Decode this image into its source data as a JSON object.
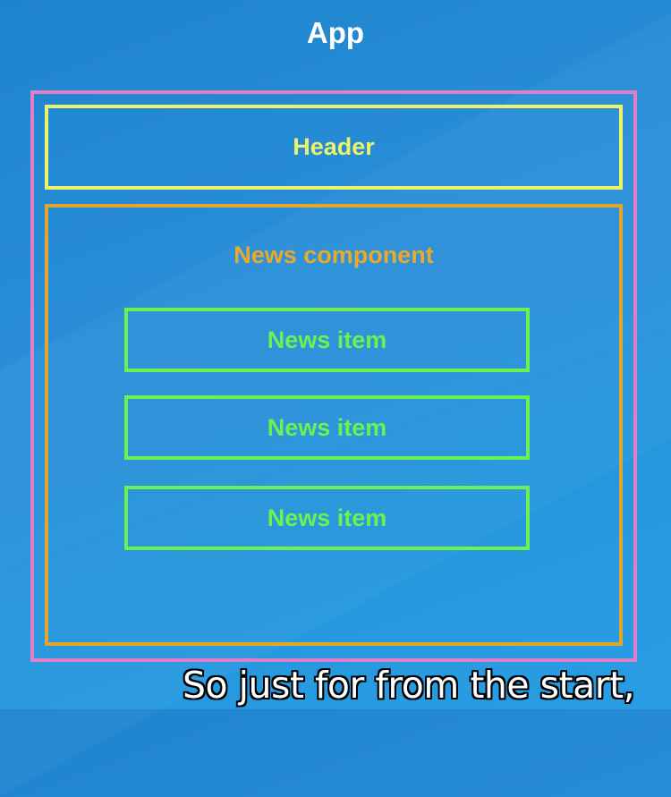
{
  "diagram": {
    "title": "App",
    "header_label": "Header",
    "news_component_label": "News component",
    "news_items": [
      "News item",
      "News item",
      "News item"
    ]
  },
  "caption": {
    "text": "So just for from the start,"
  },
  "colors": {
    "background": "#2a8fd8",
    "app_border": "#e07fc8",
    "header": "#ecf36a",
    "news_component": "#e1a72c",
    "news_item": "#6cf052"
  }
}
